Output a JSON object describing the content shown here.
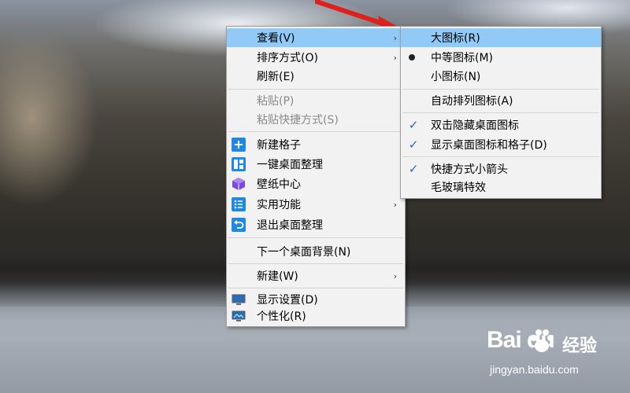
{
  "main_menu": {
    "items": [
      {
        "label": "查看(V)"
      },
      {
        "label": "排序方式(O)"
      },
      {
        "label": "刷新(E)"
      },
      {
        "label": "粘贴(P)"
      },
      {
        "label": "粘贴快捷方式(S)"
      },
      {
        "label": "新建格子"
      },
      {
        "label": "一键桌面整理"
      },
      {
        "label": "壁纸中心"
      },
      {
        "label": "实用功能"
      },
      {
        "label": "退出桌面整理"
      },
      {
        "label": "下一个桌面背景(N)"
      },
      {
        "label": "新建(W)"
      },
      {
        "label": "显示设置(D)"
      },
      {
        "label": "个性化(R)"
      }
    ],
    "arrow_glyph": "›"
  },
  "sub_menu": {
    "items": [
      {
        "label": "大图标(R)"
      },
      {
        "label": "中等图标(M)"
      },
      {
        "label": "小图标(N)"
      },
      {
        "label": "自动排列图标(A)"
      },
      {
        "label": "双击隐藏桌面图标"
      },
      {
        "label": "显示桌面图标和格子(D)"
      },
      {
        "label": "快捷方式小箭头"
      },
      {
        "label": "毛玻璃特效"
      }
    ],
    "check_glyph": "✓"
  },
  "watermark": {
    "brand": "Bai  du",
    "cn": "经验",
    "url": "jingyan.baidu.com"
  },
  "colors": {
    "hover": "#91c9f7",
    "menu_bg": "#f2f2f2",
    "icon_blue": "#1e88e5",
    "icon_purple": "#7b4ae2",
    "arrow_red": "#e0201a"
  }
}
